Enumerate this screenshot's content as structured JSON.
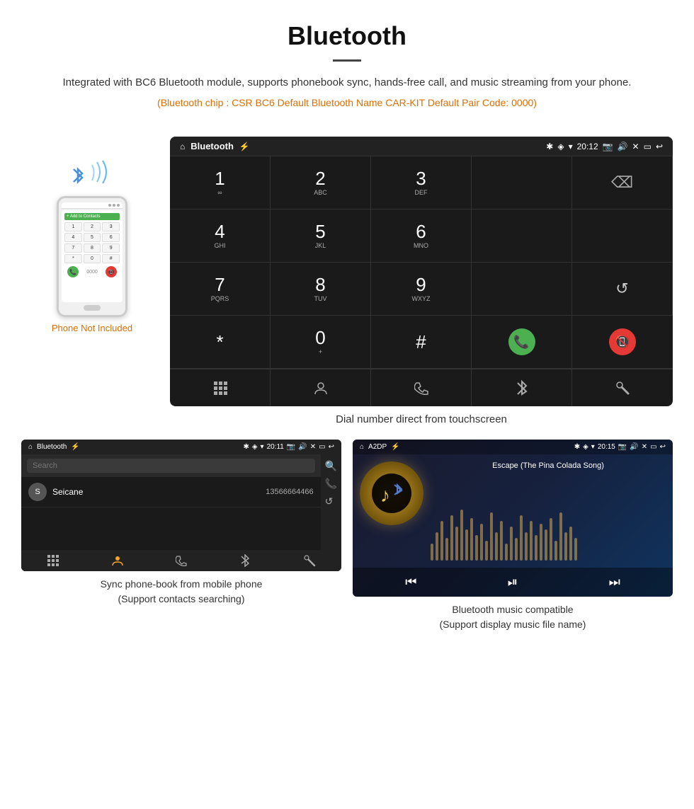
{
  "header": {
    "title": "Bluetooth",
    "divider": true,
    "description": "Integrated with BC6 Bluetooth module, supports phonebook sync, hands-free call, and music streaming from your phone.",
    "bluetooth_info": "(Bluetooth chip : CSR BC6    Default Bluetooth Name CAR-KIT    Default Pair Code: 0000)"
  },
  "phone_mockup": {
    "not_included_label": "Phone Not Included"
  },
  "dial_screen": {
    "title": "Bluetooth",
    "usb_icon": "⚡",
    "time": "20:12",
    "keys": [
      {
        "number": "1",
        "letters": "∞"
      },
      {
        "number": "2",
        "letters": "ABC"
      },
      {
        "number": "3",
        "letters": "DEF"
      },
      {
        "number": "",
        "letters": ""
      },
      {
        "number": "",
        "letters": ""
      },
      {
        "number": "4",
        "letters": "GHI"
      },
      {
        "number": "5",
        "letters": "JKL"
      },
      {
        "number": "6",
        "letters": "MNO"
      },
      {
        "number": "",
        "letters": ""
      },
      {
        "number": "",
        "letters": ""
      },
      {
        "number": "7",
        "letters": "PQRS"
      },
      {
        "number": "8",
        "letters": "TUV"
      },
      {
        "number": "9",
        "letters": "WXYZ"
      },
      {
        "number": "",
        "letters": ""
      },
      {
        "number": "",
        "letters": ""
      },
      {
        "number": "*",
        "letters": ""
      },
      {
        "number": "0",
        "letters": "+"
      },
      {
        "number": "#",
        "letters": ""
      },
      {
        "number": "",
        "letters": ""
      },
      {
        "number": "",
        "letters": ""
      }
    ],
    "bottom_icons": [
      "⊞",
      "👤",
      "📞",
      "✱",
      "🔗"
    ],
    "caption": "Dial number direct from touchscreen"
  },
  "phonebook_screen": {
    "title": "Bluetooth",
    "time": "20:11",
    "search_placeholder": "Search",
    "contact_initial": "S",
    "contact_name": "Seicane",
    "contact_number": "13566664466",
    "caption_line1": "Sync phone-book from mobile phone",
    "caption_line2": "(Support contacts searching)"
  },
  "music_screen": {
    "title": "A2DP",
    "time": "20:15",
    "song_title": "Escape (The Pina Colada Song)",
    "music_icon": "♪",
    "caption_line1": "Bluetooth music compatible",
    "caption_line2": "(Support display music file name)"
  }
}
